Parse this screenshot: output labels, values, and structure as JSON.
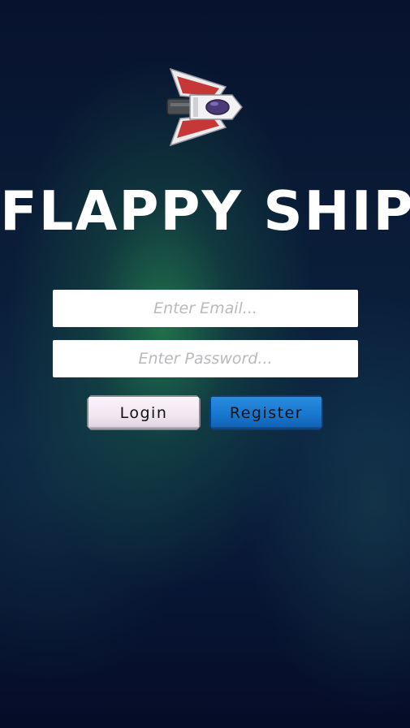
{
  "game": {
    "title": "FLAPPY SHIP",
    "logo_icon": "spaceship-icon"
  },
  "login_form": {
    "email_placeholder": "Enter Email...",
    "email_value": "",
    "password_placeholder": "Enter Password...",
    "password_value": "",
    "login_label": "Login",
    "register_label": "Register"
  },
  "colors": {
    "background": "#08122e",
    "glow": "#288c50",
    "login_button": "#f0e6ef",
    "register_button": "#1877cf",
    "ship_wing": "#c93a3a"
  }
}
